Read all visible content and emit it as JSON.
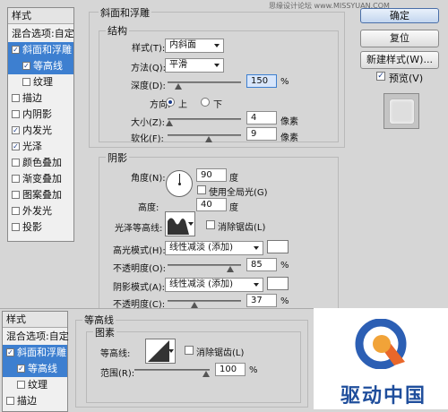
{
  "watermark": "思缘设计论坛 www.MISSYUAN.COM",
  "style_list": {
    "header": "样式",
    "items": [
      {
        "label": "混合选项:自定",
        "checkbox": false,
        "checked": false,
        "selected": false,
        "indent": false
      },
      {
        "label": "斜面和浮雕",
        "checkbox": true,
        "checked": true,
        "selected": true,
        "indent": false
      },
      {
        "label": "等高线",
        "checkbox": true,
        "checked": true,
        "selected": true,
        "indent": true
      },
      {
        "label": "纹理",
        "checkbox": true,
        "checked": false,
        "selected": false,
        "indent": true
      },
      {
        "label": "描边",
        "checkbox": true,
        "checked": false,
        "selected": false,
        "indent": false
      },
      {
        "label": "内阴影",
        "checkbox": true,
        "checked": false,
        "selected": false,
        "indent": false
      },
      {
        "label": "内发光",
        "checkbox": true,
        "checked": true,
        "selected": false,
        "indent": false
      },
      {
        "label": "光泽",
        "checkbox": true,
        "checked": true,
        "selected": false,
        "indent": false
      },
      {
        "label": "颜色叠加",
        "checkbox": true,
        "checked": false,
        "selected": false,
        "indent": false
      },
      {
        "label": "渐变叠加",
        "checkbox": true,
        "checked": false,
        "selected": false,
        "indent": false
      },
      {
        "label": "图案叠加",
        "checkbox": true,
        "checked": false,
        "selected": false,
        "indent": false
      },
      {
        "label": "外发光",
        "checkbox": true,
        "checked": false,
        "selected": false,
        "indent": false
      },
      {
        "label": "投影",
        "checkbox": true,
        "checked": false,
        "selected": false,
        "indent": false
      }
    ]
  },
  "bevel": {
    "section_title": "斜面和浮雕",
    "structure_title": "结构",
    "style_label": "样式(T):",
    "style_value": "内斜面",
    "method_label": "方法(Q):",
    "method_value": "平滑",
    "depth_label": "深度(D):",
    "depth_value": "150",
    "depth_unit": "%",
    "depth_fraction": 0.15,
    "direction_label": "方向:",
    "dir_up": "上",
    "dir_down": "下",
    "direction_selected": "上",
    "size_label": "大小(Z):",
    "size_value": "4",
    "size_unit": "像素",
    "size_fraction": 0.03,
    "soften_label": "软化(F):",
    "soften_value": "9",
    "soften_unit": "像素",
    "soften_fraction": 0.56
  },
  "shading": {
    "title": "阴影",
    "angle_label": "角度(N):",
    "angle_value": "90",
    "angle_unit": "度",
    "global_light_label": "使用全局光(G)",
    "global_light_checked": false,
    "altitude_label": "高度:",
    "altitude_value": "40",
    "altitude_unit": "度",
    "gloss_contour_label": "光泽等高线:",
    "anti_alias_label": "消除锯齿(L)",
    "anti_alias_checked": false,
    "highlight_mode_label": "高光模式(H):",
    "highlight_mode_value": "线性减淡 (添加)",
    "highlight_color": "#ffffff",
    "highlight_opacity_label": "不透明度(O):",
    "highlight_opacity_value": "85",
    "highlight_opacity_fraction": 0.85,
    "shadow_mode_label": "阴影模式(A):",
    "shadow_mode_value": "线性减淡 (添加)",
    "shadow_color": "#ffffff",
    "shadow_opacity_label": "不透明度(C):",
    "shadow_opacity_value": "37",
    "shadow_opacity_fraction": 0.37,
    "percent": "%"
  },
  "buttons": {
    "ok": "确定",
    "reset": "复位",
    "new_style": "新建样式(W)...",
    "preview_label": "预览(V)",
    "preview_checked": true
  },
  "overlay_list": {
    "header": "样式",
    "items": [
      {
        "label": "混合选项:自定",
        "checkbox": false,
        "checked": false,
        "selected": false,
        "indent": false
      },
      {
        "label": "斜面和浮雕",
        "checkbox": true,
        "checked": true,
        "selected": true,
        "indent": false
      },
      {
        "label": "等高线",
        "checkbox": true,
        "checked": true,
        "selected": true,
        "indent": true
      },
      {
        "label": "纹理",
        "checkbox": true,
        "checked": false,
        "selected": false,
        "indent": true
      },
      {
        "label": "描边",
        "checkbox": true,
        "checked": false,
        "selected": false,
        "indent": false
      }
    ]
  },
  "contour_panel": {
    "title": "等高线",
    "subtitle": "图素",
    "contour_label": "等高线:",
    "anti_alias_label": "消除锯齿(L)",
    "range_label": "范围(R):",
    "range_value": "100",
    "range_unit": "%",
    "range_fraction": 0.95
  },
  "logo_text": "驱动中国"
}
